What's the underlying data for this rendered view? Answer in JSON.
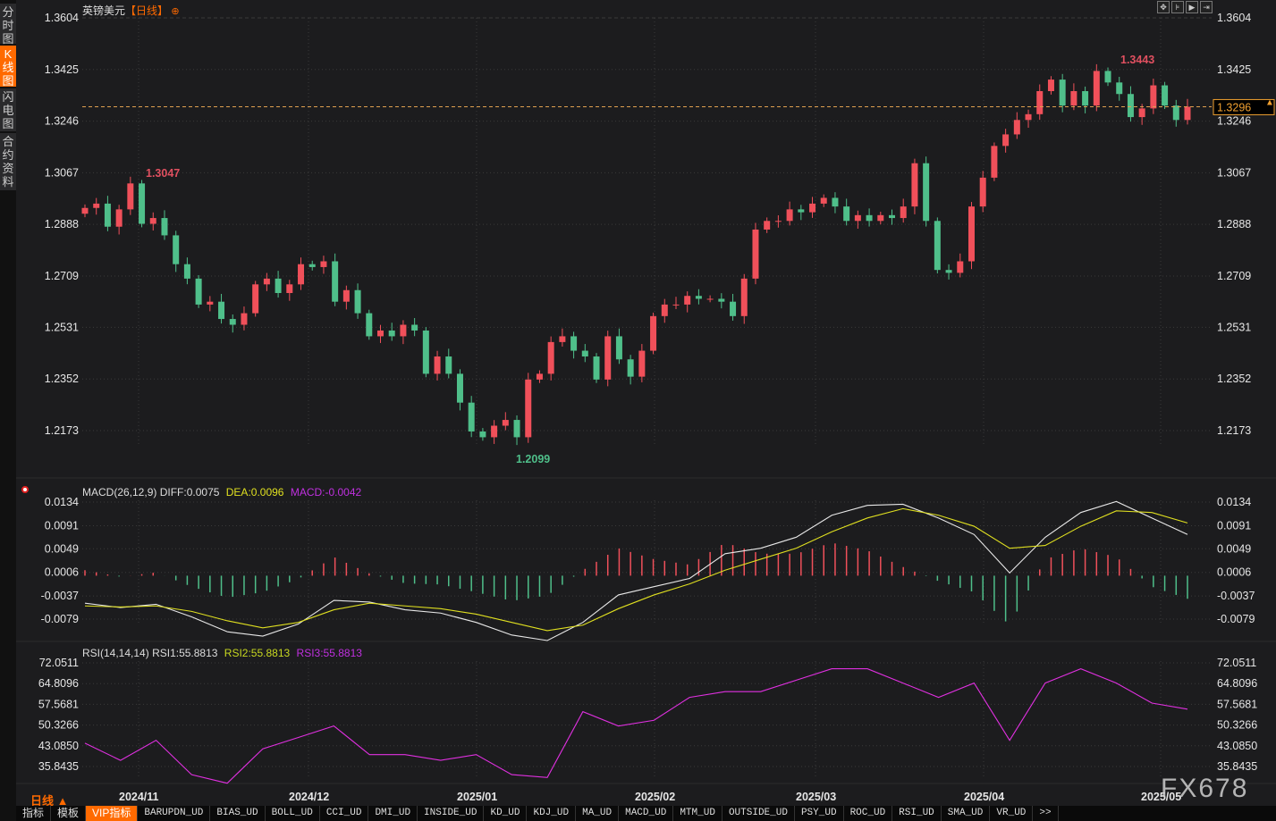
{
  "sidebar": {
    "tabs": [
      {
        "label": "分时图"
      },
      {
        "label": "K线图",
        "active": true
      },
      {
        "label": "闪电图"
      },
      {
        "label": "合约资料"
      }
    ]
  },
  "header": {
    "symbol": "英镑美元",
    "period": "【日线】",
    "add_icon": "circle-plus-icon"
  },
  "toolbar": {
    "icons": [
      "crosshair-icon",
      "zoom-in-icon",
      "play-forward-icon",
      "move-right-icon"
    ]
  },
  "price_axis": {
    "labels": [
      "1.3604",
      "1.3425",
      "1.3246",
      "1.3067",
      "1.2888",
      "1.2709",
      "1.2531",
      "1.2352",
      "1.2173"
    ],
    "current": "1.3296"
  },
  "annotations": {
    "high_left": "1.3047",
    "low": "1.2099",
    "high_right": "1.3443"
  },
  "macd": {
    "title": "MACD(26,12,9)",
    "diff": "DIFF:0.0075",
    "dea": "DEA:0.0096",
    "macd": "MACD:-0.0042",
    "axis": [
      "0.0134",
      "0.0091",
      "0.0049",
      "0.0006",
      "-0.0037",
      "-0.0079"
    ]
  },
  "rsi": {
    "title": "RSI(14,14,14)",
    "rsi1": "RSI1:55.8813",
    "rsi2": "RSI2:55.8813",
    "rsi3": "RSI3:55.8813",
    "axis": [
      "72.0511",
      "64.8096",
      "57.5681",
      "50.3266",
      "43.0850",
      "35.8435"
    ]
  },
  "period_selector": {
    "label": "日线 ▲"
  },
  "x_axis": {
    "labels": [
      "2024/11",
      "2024/12",
      "2025/01",
      "2025/02",
      "2025/03",
      "2025/04",
      "2025/05"
    ]
  },
  "watermark": "FX678",
  "bottom_tabs": [
    "指标",
    "模板",
    "VIP指标",
    "BARUPDN_UD",
    "BIAS_UD",
    "BOLL_UD",
    "CCI_UD",
    "DMI_UD",
    "INSIDE_UD",
    "KD_UD",
    "KDJ_UD",
    "MA_UD",
    "MACD_UD",
    "MTM_UD",
    "OUTSIDE_UD",
    "PSY_UD",
    "ROC_UD",
    "RSI_UD",
    "SMA_UD",
    "VR_UD",
    ">>"
  ],
  "colors": {
    "up": "#f0505a",
    "down": "#4fbf8a",
    "diff": "#e8e8e8",
    "dea": "#e0e020",
    "rsi": "#e030e0",
    "accent": "#ff6a00",
    "background": "#1c1c1e"
  },
  "chart_data": {
    "type": "candlestick",
    "price_range": [
      1.2173,
      1.3604
    ],
    "close": [
      1.2945,
      1.296,
      1.288,
      1.294,
      1.303,
      1.289,
      1.291,
      1.285,
      1.275,
      1.27,
      1.261,
      1.262,
      1.256,
      1.254,
      1.258,
      1.268,
      1.27,
      1.265,
      1.268,
      1.275,
      1.274,
      1.276,
      1.262,
      1.266,
      1.258,
      1.25,
      1.252,
      1.25,
      1.254,
      1.252,
      1.237,
      1.243,
      1.237,
      1.227,
      1.217,
      1.215,
      1.219,
      1.221,
      1.215,
      1.235,
      1.237,
      1.248,
      1.25,
      1.245,
      1.243,
      1.235,
      1.25,
      1.242,
      1.236,
      1.245,
      1.257,
      1.261,
      1.261,
      1.264,
      1.263,
      1.263,
      1.262,
      1.257,
      1.27,
      1.287,
      1.29,
      1.29,
      1.294,
      1.293,
      1.296,
      1.298,
      1.295,
      1.29,
      1.292,
      1.29,
      1.292,
      1.291,
      1.295,
      1.31,
      1.29,
      1.273,
      1.272,
      1.276,
      1.295,
      1.305,
      1.316,
      1.32,
      1.325,
      1.327,
      1.335,
      1.339,
      1.33,
      1.335,
      1.33,
      1.342,
      1.338,
      1.334,
      1.326,
      1.329,
      1.337,
      1.33,
      1.325,
      1.3296
    ],
    "macd_diff": [
      -0.005,
      -0.0058,
      -0.0052,
      -0.0075,
      -0.0102,
      -0.011,
      -0.0088,
      -0.0045,
      -0.0048,
      -0.0062,
      -0.0068,
      -0.0085,
      -0.0108,
      -0.0118,
      -0.0085,
      -0.0035,
      -0.002,
      -0.0005,
      0.004,
      0.005,
      0.007,
      0.011,
      0.0128,
      0.013,
      0.0105,
      0.0075,
      0.0005,
      0.007,
      0.0115,
      0.0135,
      0.0105,
      0.0075
    ],
    "macd_dea": [
      -0.0055,
      -0.0057,
      -0.0055,
      -0.0065,
      -0.0082,
      -0.0095,
      -0.0085,
      -0.0062,
      -0.005,
      -0.0055,
      -0.006,
      -0.007,
      -0.0085,
      -0.01,
      -0.009,
      -0.006,
      -0.0035,
      -0.0015,
      0.001,
      0.003,
      0.005,
      0.008,
      0.0105,
      0.0122,
      0.011,
      0.009,
      0.005,
      0.0055,
      0.009,
      0.0118,
      0.0115,
      0.0096
    ],
    "macd_range": [
      -0.0079,
      0.0134
    ],
    "rsi": [
      44,
      38,
      45,
      33,
      30,
      42,
      46,
      50,
      40,
      40,
      38,
      40,
      33,
      32,
      55,
      50,
      52,
      60,
      62,
      62,
      66,
      70,
      70,
      65,
      60,
      65,
      45,
      65,
      70,
      65,
      58,
      55.88
    ],
    "rsi_range": [
      35.8435,
      72.0511
    ]
  }
}
